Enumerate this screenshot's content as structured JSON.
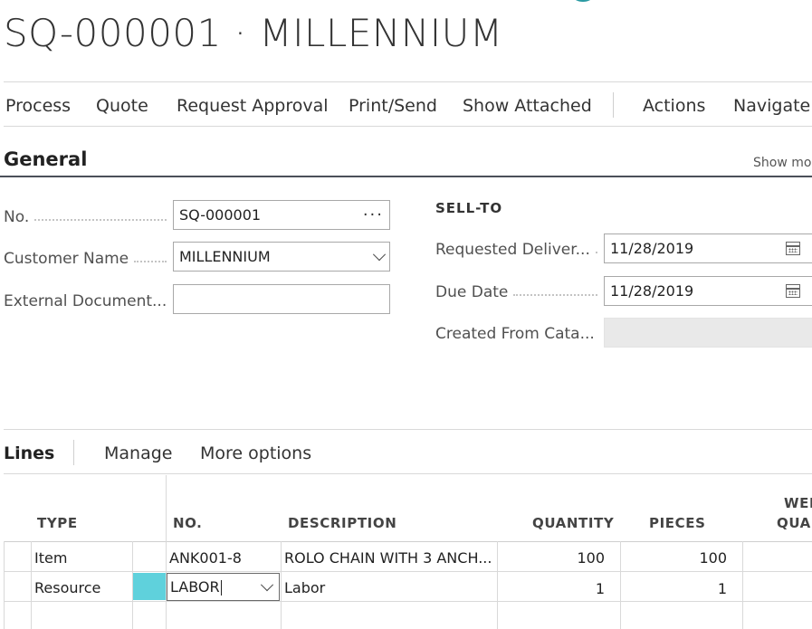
{
  "page": {
    "title": "SQ-000001 · MILLENNIUM"
  },
  "action_bar": {
    "items": [
      "Process",
      "Quote",
      "Request Approval",
      "Print/Send",
      "Show Attached"
    ],
    "more_items": [
      "Actions",
      "Navigate"
    ]
  },
  "general": {
    "heading": "General",
    "show_more": "Show mor",
    "left_fields": [
      {
        "label": "No.",
        "value": "SQ-000001",
        "control": "lookup"
      },
      {
        "label": "Customer Name",
        "value": "MILLENNIUM",
        "control": "dropdown"
      },
      {
        "label": "External Document...",
        "value": "",
        "control": "text"
      }
    ],
    "sell_to_heading": "SELL-TO",
    "right_fields": [
      {
        "label": "Requested Deliver...",
        "value": "11/28/2019",
        "control": "date"
      },
      {
        "label": "Due Date",
        "value": "11/28/2019",
        "control": "date"
      },
      {
        "label": "Created From Cata...",
        "value": "",
        "control": "disabled"
      }
    ],
    "icons": {
      "lookup": "ellipsis-icon",
      "dropdown": "chevron-down-icon",
      "date": "calendar-icon"
    }
  },
  "lines": {
    "heading": "Lines",
    "menu": [
      "Manage",
      "More options"
    ],
    "columns": {
      "type": "TYPE",
      "no": "NO.",
      "description": "DESCRIPTION",
      "quantity": "QUANTITY",
      "pieces": "PIECES",
      "weight_line1": "WEI",
      "weight_line2": "QUAN"
    },
    "rows": [
      {
        "type": "Item",
        "no": "ANK001-8",
        "description": "ROLO CHAIN WITH 3 ANCH...",
        "quantity": "100",
        "pieces": "100"
      },
      {
        "type": "Resource",
        "no": "LABOR",
        "description": "Labor",
        "quantity": "1",
        "pieces": "1"
      }
    ]
  },
  "colors": {
    "accent": "#5fd1dc",
    "header_rule": "#4a4f59",
    "brand_teal": "#2a9aa3"
  }
}
